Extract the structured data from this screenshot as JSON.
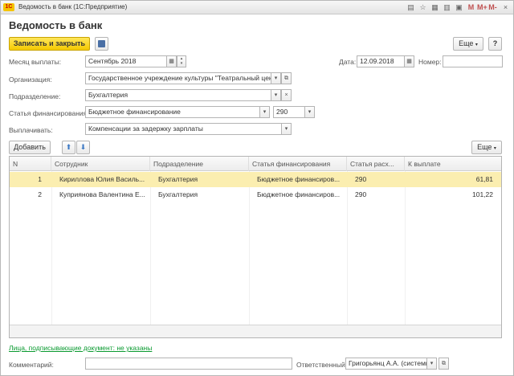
{
  "titlebar": {
    "logo": "1С",
    "title": "Ведомость в банк  (1С:Предприятие)",
    "icons": [
      "doc-icon",
      "star-icon",
      "table-icon",
      "calendar-icon",
      "calc-icon",
      "memory-M-icon",
      "memory-plus-icon",
      "memory-minus-icon"
    ],
    "m_label": "M",
    "mplus_label": "M+",
    "mminus_label": "M-"
  },
  "header": {
    "title": "Ведомость в банк",
    "save_close_label": "Записать и закрыть",
    "more_label": "Еще",
    "help_label": "?"
  },
  "form": {
    "month_label": "Месяц выплаты:",
    "month_value": "Сентябрь 2018",
    "date_label": "Дата:",
    "date_value": "12.09.2018",
    "number_label": "Номер:",
    "number_value": "",
    "org_label": "Организация:",
    "org_value": "Государственное учреждение культуры \"Театральный центр",
    "dept_label": "Подразделение:",
    "dept_value": "Бухгалтерия",
    "fin_label": "Статья финансирования:",
    "fin_value": "Бюджетное финансирование",
    "fin_code": "290",
    "pay_label": "Выплачивать:",
    "pay_value": "Компенсации за задержку зарплаты"
  },
  "table_toolbar": {
    "add_label": "Добавить",
    "more_label": "Еще"
  },
  "table": {
    "columns": [
      "N",
      "Сотрудник",
      "Подразделение",
      "Статья финансирования",
      "Статья расх...",
      "К выплате"
    ],
    "rows": [
      {
        "n": "1",
        "employee": "Кириллова Юлия Василь...",
        "dept": "Бухгалтерия",
        "fin": "Бюджетное финансиров...",
        "exp": "290",
        "amount": "61,81"
      },
      {
        "n": "2",
        "employee": "Куприянова Валентина Е...",
        "dept": "Бухгалтерия",
        "fin": "Бюджетное финансиров...",
        "exp": "290",
        "amount": "101,22"
      }
    ]
  },
  "footer": {
    "signers_link": "Лица, подписывающие документ: не указаны",
    "comment_label": "Комментарий:",
    "comment_value": "",
    "responsible_label": "Ответственный:",
    "responsible_value": "Григорьянц А.А. (системн"
  },
  "colors": {
    "primary_button": "#f4c900",
    "selected_row": "#fbeeb0",
    "link": "#0a9a30",
    "logo": "#f4c400"
  }
}
